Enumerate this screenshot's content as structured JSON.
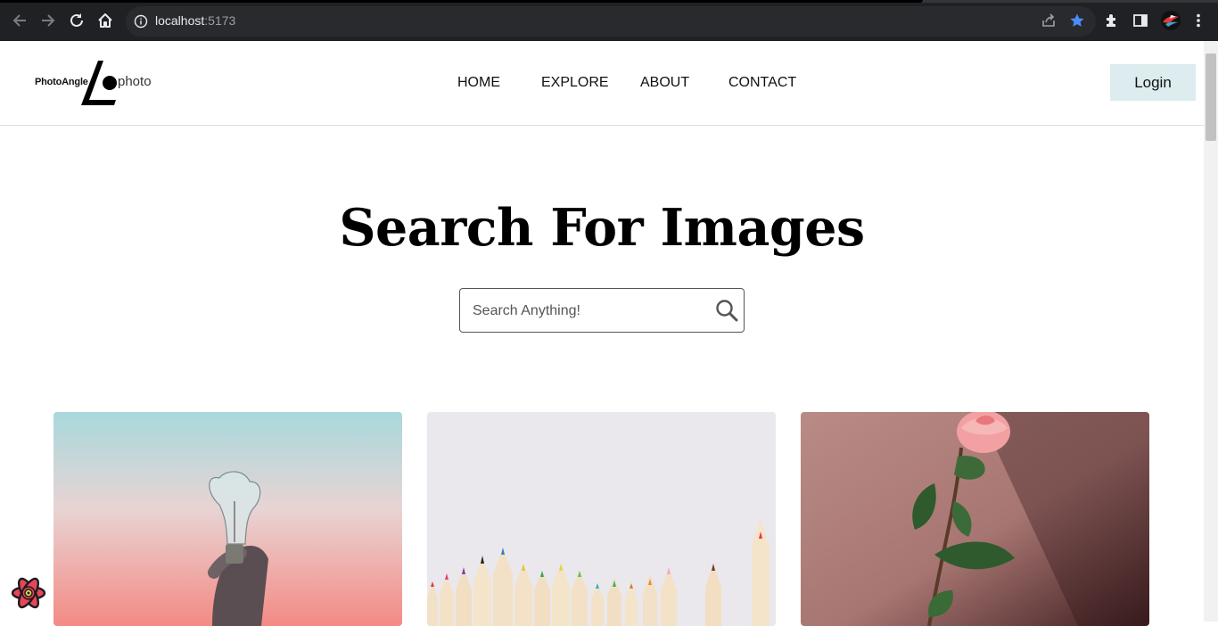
{
  "browser": {
    "url_host": "localhost",
    "url_port": ":5173"
  },
  "header": {
    "logo_left": "PhotoAngle",
    "logo_right": "photo",
    "nav": [
      "HOME",
      "EXPLORE",
      "ABOUT",
      "CONTACT"
    ],
    "login_label": "Login"
  },
  "hero": {
    "title": "Search For Images",
    "search_placeholder": "Search Anything!"
  },
  "gallery": {
    "images": [
      "lightbulb-photo",
      "colored-pencils-photo",
      "pink-rose-photo"
    ]
  },
  "colors": {
    "chrome_bg": "#202124",
    "omnibox_bg": "#282a2d",
    "login_bg": "#dcecef",
    "star_blue": "#8ab4f8"
  }
}
